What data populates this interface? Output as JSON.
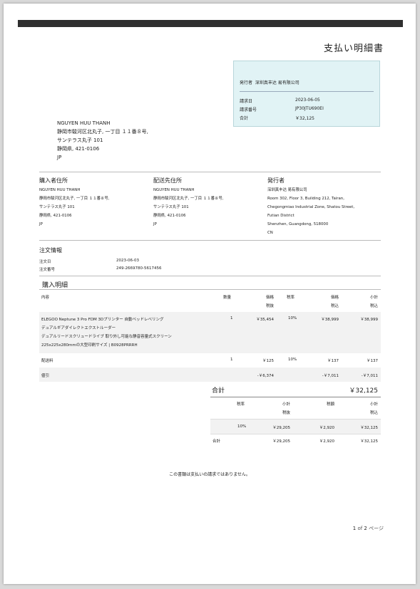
{
  "title": "支払い明細書",
  "infobox": {
    "issuer_label": "発行者",
    "issuer_name": "深圳真丰达 易有限公司",
    "rows": [
      {
        "label": "請求日",
        "value": "2023-06-05"
      },
      {
        "label": "請求番号",
        "value": "JP30JTU690EI"
      },
      {
        "label": "合計",
        "value": "￥32,125"
      }
    ]
  },
  "recipient": [
    "NGUYEN HUU THANH",
    "静岡市駿河区北丸子, 一丁目 １１番８号,",
    "サンテラス丸子 101",
    "静岡県, 421-0106",
    "JP"
  ],
  "buyer": {
    "heading": "購入者住所",
    "lines": [
      "NGUYEN HUU THANH",
      "静岡市駿河区北丸子, 一丁目 １１番８号,",
      "サンテラス丸子 101",
      "静岡県, 421-0106",
      "JP"
    ]
  },
  "shipping": {
    "heading": "配送先住所",
    "lines": [
      "NGUYEN HUU THANH",
      "静岡市駿河区北丸子, 一丁目 １１番８号,",
      "サンテラス丸子 101",
      "静岡県, 421-0106",
      "JP"
    ]
  },
  "seller": {
    "heading": "発行者",
    "lines": [
      "深圳真丰达 易有限公司",
      "Room 302, Floor 3, Building 212, Tairan,",
      "Chegongmiao Industrial Zone, Shatou Street,",
      "Futian District",
      "Shenzhen, Guangdong, 518000",
      "CN"
    ]
  },
  "order": {
    "heading": "注文情報",
    "date_label": "注文日",
    "date": "2023-06-03",
    "number_label": "注文番号",
    "number": "249-2669780-5617456"
  },
  "items": {
    "heading": "購入明細",
    "headers": {
      "desc": "内容",
      "qty": "数量",
      "price": "価格",
      "price_sub": "税抜",
      "tax": "税率",
      "price_in": "価格",
      "price_in_sub": "税込",
      "subtotal": "小計",
      "subtotal_sub": "税込"
    },
    "product": {
      "lines": [
        "ELEGOO Neptune 3 Pro FDM 3Dプリンター 自動ベッドレベリング",
        "デュアルギアダイレクトエクストルーダー",
        "デュアルリードスクリュードライブ 取り外し可能な静音容量式スクリーン",
        "225x225x280mmの大型印刷サイズ | B0928PRRRH"
      ],
      "qty": "1",
      "price": "￥35,454",
      "tax": "10%",
      "price_in": "￥38,999",
      "subtotal": "￥38,999"
    },
    "shipping_fee": {
      "label": "配送料",
      "qty": "1",
      "price": "￥125",
      "tax": "10%",
      "price_in": "￥137",
      "subtotal": "￥137"
    },
    "discount": {
      "label": "値引",
      "price": "-￥6,374",
      "price_in": "-￥7,011",
      "subtotal": "-￥7,011"
    }
  },
  "total": {
    "label": "合計",
    "value": "￥32,125"
  },
  "summary": {
    "headers": {
      "rate": "税率",
      "subtotal": "小計",
      "subtotal_sub": "税抜",
      "tax": "税額",
      "total": "小計",
      "total_sub": "税込"
    },
    "row": {
      "rate": "10%",
      "subtotal": "￥29,205",
      "tax": "￥2,920",
      "total": "￥32,125"
    },
    "sum": {
      "label": "合計",
      "subtotal": "￥29,205",
      "tax": "￥2,920",
      "total": "￥32,125"
    }
  },
  "notice": "この書類は支払いの請求ではありません。",
  "pager": {
    "current": "1",
    "of": "of",
    "total": "2",
    "suffix": "ページ"
  }
}
